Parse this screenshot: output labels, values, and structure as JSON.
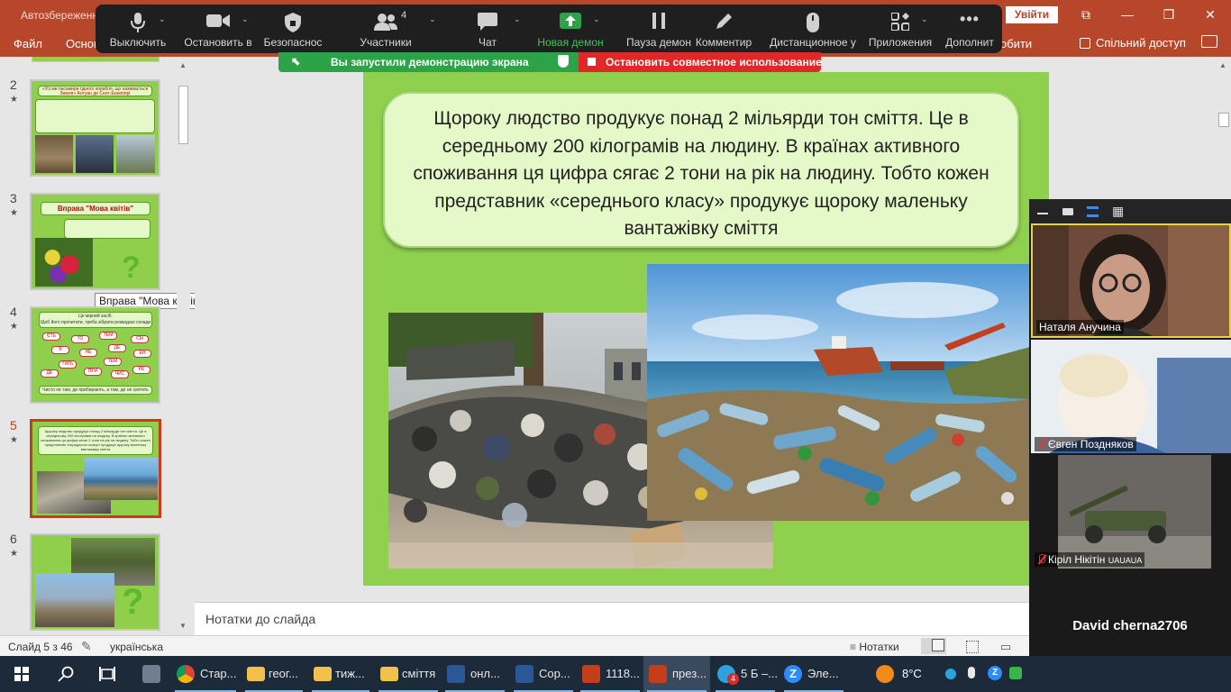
{
  "powerpoint": {
    "autosave_label": "Автозбереженн",
    "signin_button": "Увійти",
    "ribbon_tabs": [
      "Файл",
      "Основ",
      "обити"
    ],
    "share_label": "Спільний доступ"
  },
  "zoom_toolbar": {
    "buttons": [
      {
        "label": "Выключить",
        "icon": "microphone-icon"
      },
      {
        "label": "Остановить в",
        "icon": "video-camera-icon"
      },
      {
        "label": "Безопаснос",
        "icon": "shield-icon"
      },
      {
        "label": "Участники",
        "icon": "participants-icon",
        "count": "4"
      },
      {
        "label": "Чат",
        "icon": "chat-bubble-icon"
      },
      {
        "label": "Новая демон",
        "icon": "new-share-icon"
      },
      {
        "label": "Пауза демон",
        "icon": "pause-icon"
      },
      {
        "label": "Комментир",
        "icon": "pencil-icon"
      },
      {
        "label": "Дистанционное у",
        "icon": "mouse-icon"
      },
      {
        "label": "Приложения",
        "icon": "apps-icon"
      },
      {
        "label": "Дополнит",
        "icon": "more-dots-icon"
      }
    ],
    "share_banner": "Вы запустили демонстрацию экрана",
    "stop_share": "Остановить совместное использование",
    "accent_green": "#2ca346",
    "stop_red": "#e02828"
  },
  "thumbnails": {
    "slides": [
      {
        "number": "2",
        "title": "«Усі ми пасажири одного корабля, що називається Земля»  Антуан де Сент-Екзюпері"
      },
      {
        "number": "3",
        "title": "Вправа \"Мова квітів\""
      },
      {
        "number": "4",
        "title": "Це мірний засіб.",
        "subtitle": "Щоб його прочитати, треба зібрати розкидані склади",
        "words": [
          "ЄТЬ",
          "ТО",
          "ТЕМ",
          "СМ",
          "В",
          "НЕ",
          "ДЕ",
          "ЕН",
          "ТЯТЬ",
          "ТЕМ",
          "ДЕ",
          "ПРИ",
          "ЧИС",
          "РЕ"
        ],
        "footer": "Чисто не там, де прибирають, а там, де не смітять"
      },
      {
        "number": "5",
        "selected": true
      },
      {
        "number": "6"
      }
    ],
    "tooltip": "Вправа \"Мова квітів\""
  },
  "slide": {
    "text": "Щороку людство продукує понад 2 мільярди тон сміття. Це в середньому 200 кілограмів на людину. В країнах активного споживання ця цифра сягає 2 тони на рік на людину. Тобто кожен представник «середнього класу» продукує щороку маленьку вантажівку сміття",
    "background": "#8fd14f",
    "textbox_fill": "#e4f9c7"
  },
  "notes_placeholder": "Нотатки до слайда",
  "statusbar": {
    "slide_counter": "Слайд 5 з 46",
    "language": "українська",
    "notes_button": "Нотатки"
  },
  "participants": [
    {
      "name": "Наталя Анучина",
      "muted": false
    },
    {
      "name": "Євген Поздняков",
      "muted": true
    },
    {
      "name": "Кіріл Нікітін",
      "suffix": "UAUAUA",
      "muted": true
    },
    {
      "name": "David cherna2706",
      "muted": true
    }
  ],
  "taskbar": {
    "items": [
      {
        "label": "Стар...",
        "icon": "chrome-icon"
      },
      {
        "label": "геог...",
        "icon": "folder-icon"
      },
      {
        "label": "тиж...",
        "icon": "folder-icon"
      },
      {
        "label": "сміття",
        "icon": "folder-icon"
      },
      {
        "label": "онл...",
        "icon": "word-icon"
      },
      {
        "label": "Сор...",
        "icon": "word-icon"
      },
      {
        "label": "1118...",
        "icon": "powerpoint-icon"
      },
      {
        "label": "през...",
        "icon": "powerpoint-icon",
        "active": true
      },
      {
        "label": "5 Б –...",
        "icon": "telegram-icon",
        "badge": "4"
      },
      {
        "label": "Эле...",
        "icon": "zoom-icon"
      }
    ],
    "weather": "8°C"
  }
}
